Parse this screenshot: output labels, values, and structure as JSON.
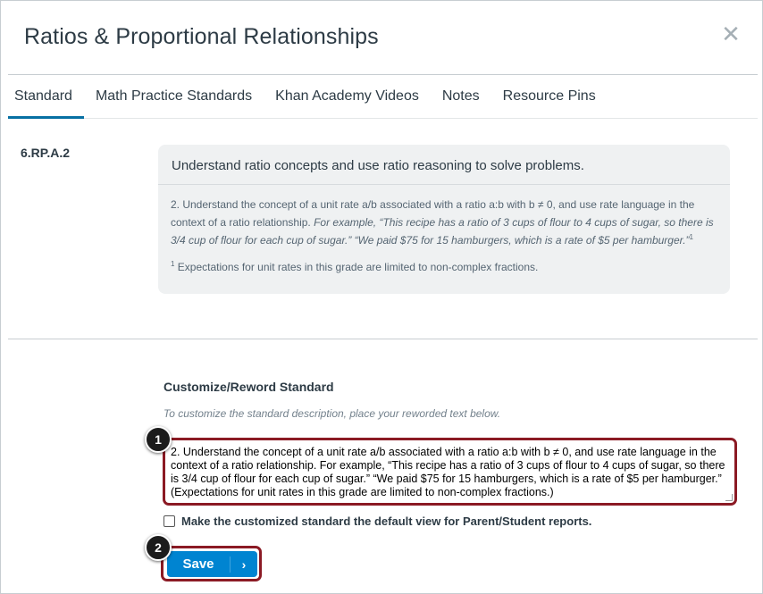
{
  "modal": {
    "title": "Ratios & Proportional Relationships",
    "close_icon": "close-icon",
    "close_glyph": "✕"
  },
  "tabs": [
    {
      "label": "Standard",
      "active": true
    },
    {
      "label": "Math Practice Standards",
      "active": false
    },
    {
      "label": "Khan Academy Videos",
      "active": false
    },
    {
      "label": "Notes",
      "active": false
    },
    {
      "label": "Resource Pins",
      "active": false
    }
  ],
  "standard": {
    "code": "6.RP.A.2",
    "heading": "Understand ratio concepts and use ratio reasoning to solve problems.",
    "description_plain": "2. Understand the concept of a unit rate a/b associated with a ratio a:b with b ≠ 0, and use rate language in the context of a ratio relationship. ",
    "description_italic": "For example, “This recipe has a ratio of 3 cups of flour to 4 cups of sugar, so there is 3/4 cup of flour for each cup of sugar.” “We paid $75 for 15 hamburgers, which is a rate of $5 per hamburger.”",
    "description_sup": "1",
    "footnote_sup": "1",
    "footnote_text": "Expectations for unit rates in this grade are limited to non-complex fractions."
  },
  "customize": {
    "title": "Customize/Reword Standard",
    "hint": "To customize the standard description, place your reworded text below.",
    "textarea_value": "2. Understand the concept of a unit rate a/b associated with a ratio a:b with b ≠ 0, and use rate language in the context of a ratio relationship. For example, “This recipe has a ratio of 3 cups of flour to 4 cups of sugar, so there is 3/4 cup of flour for each cup of sugar.” “We paid $75 for 15 hamburgers, which is a rate of $5 per hamburger.”  (Expectations for unit rates in this grade are limited to non-complex fractions.)",
    "checkbox_label": "Make the customized standard the default view for Parent/Student reports.",
    "checkbox_checked": false,
    "save_label": "Save",
    "save_caret": "›"
  },
  "callouts": {
    "one": "1",
    "two": "2"
  },
  "colors": {
    "accent": "#0770a3",
    "button": "#0084d1",
    "highlight": "#8b1a24",
    "card_bg": "#eff1f2"
  }
}
